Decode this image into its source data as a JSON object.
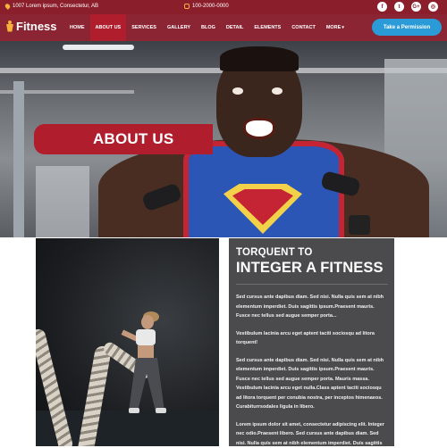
{
  "topbar": {
    "address": "1007 Lorem ipsum, Consectetur, AB",
    "phone": "100-2000-0000",
    "socials": [
      {
        "name": "facebook",
        "glyph": "f"
      },
      {
        "name": "twitter",
        "glyph": "t"
      },
      {
        "name": "google-plus",
        "glyph": "G+"
      },
      {
        "name": "instagram",
        "glyph": "◎"
      }
    ]
  },
  "header": {
    "logo": "Fitness",
    "nav": [
      {
        "label": "HOME",
        "active": false
      },
      {
        "label": "ABOUT US",
        "active": true
      },
      {
        "label": "SERVICES",
        "active": false
      },
      {
        "label": "GALLERY",
        "active": false
      },
      {
        "label": "BLOG",
        "active": false
      },
      {
        "label": "DETAIL",
        "active": false
      },
      {
        "label": "ELEMENTS",
        "active": false
      },
      {
        "label": "CONTACT",
        "active": false
      },
      {
        "label": "MORE",
        "active": false
      }
    ],
    "cta": "Take a Permission"
  },
  "hero": {
    "title": "ABOUT US"
  },
  "content": {
    "subtitle": "TORQUENT TO",
    "title": "INTEGER A FITNESS",
    "paragraphs": [
      "Sed cursus ante dapibus diam. Sed nisi. Nulla quis sem at nibh elementum imperdiet. Duis sagittis ipsum.Praesent mauris. Fusce nec tellus sed augue semper porta...",
      "Vestibulum lacinia arcu eget aptent taciti sociosqu ad litora torquent!",
      "Sed cursus ante dapibus diam. Sed nisi. Nulla quis sem at nibh elementum imperdiet. Duis sagittis ipsum.Praesent mauris. Fusce nec tellus sed augue semper porta. Mauris massa. Vestibulum lacinia arcu eget nulla.Class aptent taciti sociosqu ad litora torquent per conubia nostra, per inceptos himenaeos. Curabiturrsodales ligula in libero.",
      "Lorem ipsum dolor sit amet, consectetur adipiscing elit. Integer nec odio.Praesent libero. Sed cursus ante dapibus diam. Sed nisi. Nulla quis sem at nibh elementum imperdiet. Duis sagittis"
    ]
  },
  "colors": {
    "topbar": "#8b1e2b",
    "navbar": "#8b2433",
    "active_nav": "#b01e2e",
    "cta": "#2b9bd8",
    "banner": "#b01e2e",
    "panel": "#4b4b4d",
    "logo_icon": "#f6b23a"
  }
}
